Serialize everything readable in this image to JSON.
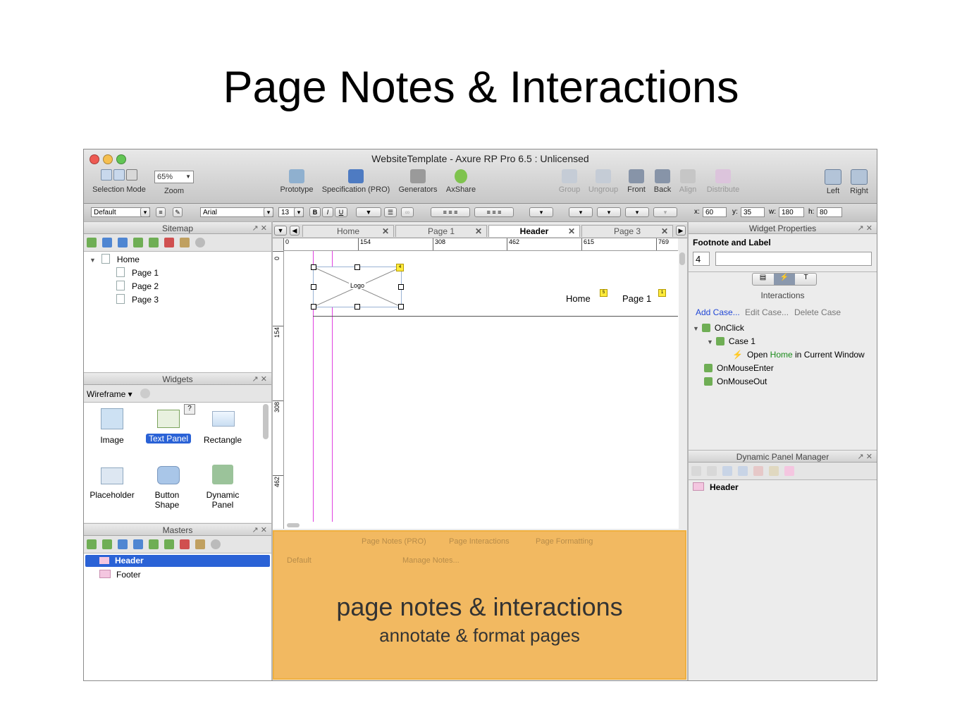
{
  "slide": {
    "title": "Page Notes & Interactions"
  },
  "window": {
    "title": "WebsiteTemplate - Axure RP Pro 6.5 : Unlicensed"
  },
  "toolbar": {
    "selection_mode": "Selection Mode",
    "zoom_value": "65%",
    "zoom": "Zoom",
    "prototype": "Prototype",
    "specification": "Specification (PRO)",
    "generators": "Generators",
    "axshare": "AxShare",
    "group": "Group",
    "ungroup": "Ungroup",
    "front": "Front",
    "back": "Back",
    "align": "Align",
    "distribute": "Distribute",
    "left": "Left",
    "right": "Right"
  },
  "formatbar": {
    "style": "Default",
    "font": "Arial",
    "size": "13",
    "bold": "B",
    "italic": "I",
    "underline": "U",
    "x_label": "x:",
    "x": "60",
    "y_label": "y:",
    "y": "35",
    "w_label": "w:",
    "w": "180",
    "h_label": "h:",
    "h": "80"
  },
  "sitemap": {
    "title": "Sitemap",
    "root": "Home",
    "pages": [
      "Page 1",
      "Page 2",
      "Page 3"
    ]
  },
  "widgets": {
    "title": "Widgets",
    "library": "Wireframe",
    "items": [
      "Image",
      "Text Panel",
      "Rectangle",
      "Placeholder",
      "Button Shape",
      "Dynamic Panel"
    ],
    "help": "?"
  },
  "masters": {
    "title": "Masters",
    "items": [
      "Header",
      "Footer"
    ]
  },
  "tabs": {
    "items": [
      "Home",
      "Page 1",
      "Header",
      "Page 3"
    ],
    "active": "Header"
  },
  "ruler": {
    "h": [
      "0",
      "154",
      "308",
      "462",
      "615",
      "769"
    ],
    "v": [
      "0",
      "154",
      "308",
      "462"
    ]
  },
  "canvas": {
    "logo": "Logo",
    "logo_note": "4",
    "nav_home": "Home",
    "nav_home_note": "5",
    "nav_page1": "Page 1",
    "nav_page1_note": "1"
  },
  "notes_panel": {
    "tab_notes": "Page Notes (PRO)",
    "tab_interactions": "Page Interactions",
    "tab_formatting": "Page Formatting",
    "select": "Default",
    "manage": "Manage Notes...",
    "overlay_title": "page notes & interactions",
    "overlay_sub": "annotate & format pages"
  },
  "widget_properties": {
    "title": "Widget Properties",
    "section": "Footnote and Label",
    "footnote": "4",
    "interactions_label": "Interactions",
    "add_case": "Add Case...",
    "edit_case": "Edit Case...",
    "delete_case": "Delete Case",
    "events": {
      "onclick": "OnClick",
      "case1": "Case 1",
      "action_open": "Open",
      "action_target": "Home",
      "action_rest": "in Current Window",
      "onmouseenter": "OnMouseEnter",
      "onmouseout": "OnMouseOut"
    }
  },
  "dynamic_panel_manager": {
    "title": "Dynamic Panel Manager",
    "items": [
      "Header"
    ]
  },
  "colors": {
    "accent": "#2a62d6",
    "overlay": "#f2b961",
    "guide": "#e040e0"
  }
}
